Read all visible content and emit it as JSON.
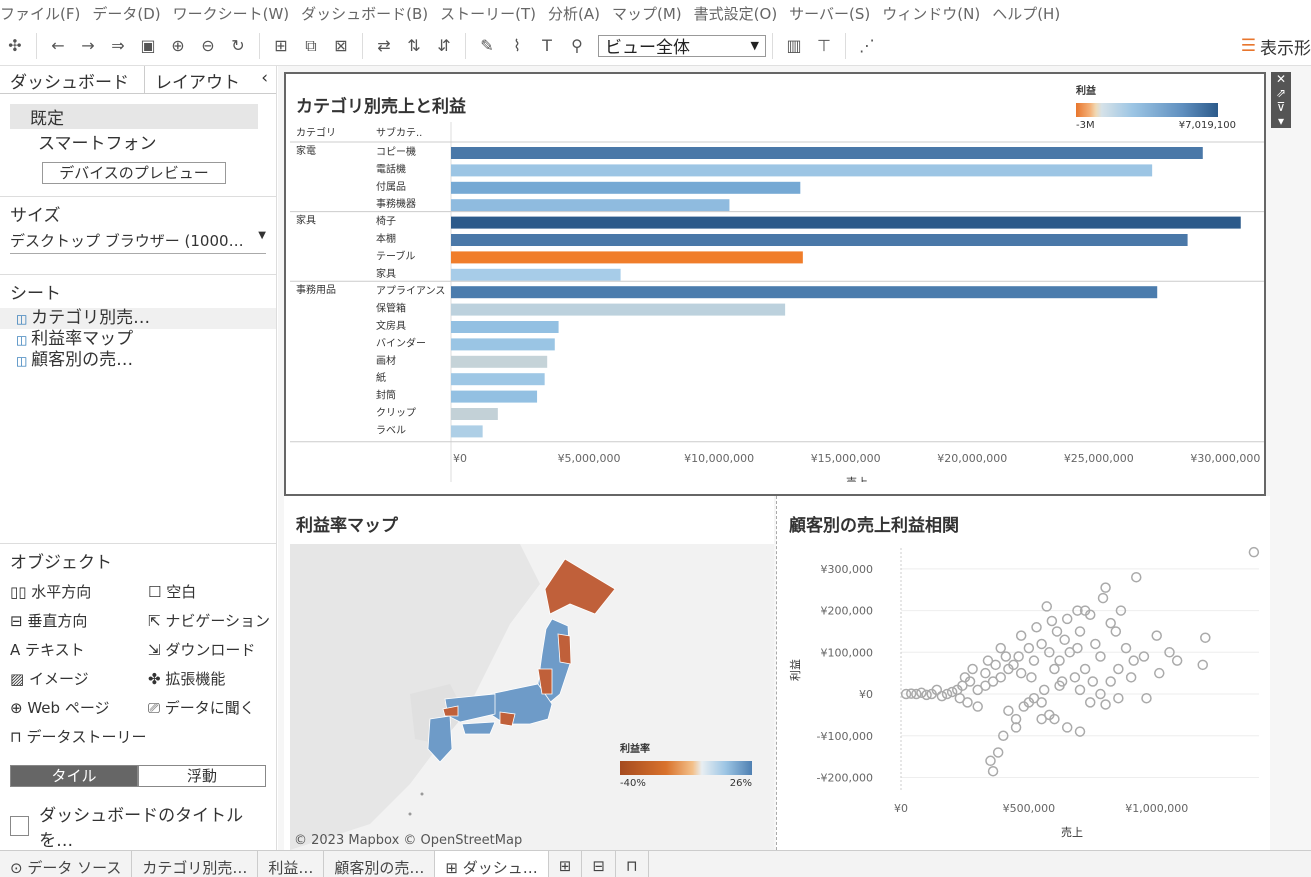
{
  "menu": [
    "ファイル(F)",
    "データ(D)",
    "ワークシート(W)",
    "ダッシュボード(B)",
    "ストーリー(T)",
    "分析(A)",
    "マップ(M)",
    "書式設定(O)",
    "サーバー(S)",
    "ウィンドウ(N)",
    "ヘルプ(H)"
  ],
  "toolbar": {
    "view_select": "ビュー全体",
    "show_me": "表示形"
  },
  "sidebar": {
    "tabs": [
      "ダッシュボード",
      "レイアウト"
    ],
    "devices": [
      "既定",
      "スマートフォン"
    ],
    "preview_button": "デバイスのプレビュー",
    "size_heading": "サイズ",
    "size_value": "デスクトップ ブラウザー (1000…",
    "sheets_heading": "シート",
    "sheets": [
      "カテゴリ別売…",
      "利益率マップ",
      "顧客別の売…"
    ],
    "objects_heading": "オブジェクト",
    "objects": [
      "水平方向",
      "空白",
      "垂直方向",
      "ナビゲーション",
      "テキスト",
      "ダウンロード",
      "イメージ",
      "拡張機能",
      "Web ページ",
      "データに聞く",
      "データストーリー"
    ],
    "tile": "タイル",
    "float": "浮動",
    "show_title": "ダッシュボードのタイトルを…"
  },
  "bottom_tabs": [
    "データ ソース",
    "カテゴリ別売…",
    "利益…",
    "顧客別の売…",
    "ダッシュ…"
  ],
  "bar_panel": {
    "title": "カテゴリ別売上と利益",
    "col_category": "カテゴリ",
    "col_subcategory": "サブカテ..",
    "legend_title": "利益",
    "legend_min": "-3M",
    "legend_max": "¥7,019,100",
    "xlabel": "売上"
  },
  "map_panel": {
    "title": "利益率マップ",
    "legend_title": "利益率",
    "legend_min": "-40%",
    "legend_max": "26%",
    "credit": "© 2023 Mapbox © OpenStreetMap"
  },
  "scatter_panel": {
    "title": "顧客別の売上利益相関",
    "xlabel": "売上",
    "ylabel": "利益"
  },
  "chart_data": [
    {
      "type": "bar",
      "title": "カテゴリ別売上と利益",
      "xlabel": "売上",
      "xlim": [
        0,
        32000000
      ],
      "xticks": [
        "¥0",
        "¥5,000,000",
        "¥10,000,000",
        "¥15,000,000",
        "¥20,000,000",
        "¥25,000,000",
        "¥30,000,000"
      ],
      "groups": [
        {
          "category": "家電",
          "items": [
            {
              "name": "コピー機",
              "value": 29700000,
              "color": "#4a78a8"
            },
            {
              "name": "電話機",
              "value": 27700000,
              "color": "#9cc5e4"
            },
            {
              "name": "付属品",
              "value": 13800000,
              "color": "#76a9d4"
            },
            {
              "name": "事務機器",
              "value": 11000000,
              "color": "#8fbbdf"
            }
          ]
        },
        {
          "category": "家具",
          "items": [
            {
              "name": "椅子",
              "value": 31200000,
              "color": "#2c5a8a"
            },
            {
              "name": "本棚",
              "value": 29100000,
              "color": "#4a78a8"
            },
            {
              "name": "テーブル",
              "value": 13900000,
              "color": "#f07d2a"
            },
            {
              "name": "家具",
              "value": 6700000,
              "color": "#a7cce8"
            }
          ]
        },
        {
          "category": "事務用品",
          "items": [
            {
              "name": "アプライアンス",
              "value": 27900000,
              "color": "#4b7cad"
            },
            {
              "name": "保管箱",
              "value": 13200000,
              "color": "#bcd1dd"
            },
            {
              "name": "文房具",
              "value": 4250000,
              "color": "#93c0e2"
            },
            {
              "name": "バインダー",
              "value": 4100000,
              "color": "#9ac5e4"
            },
            {
              "name": "画材",
              "value": 3800000,
              "color": "#c5d3d8"
            },
            {
              "name": "紙",
              "value": 3700000,
              "color": "#9ec7e5"
            },
            {
              "name": "封筒",
              "value": 3400000,
              "color": "#93c0e2"
            },
            {
              "name": "クリップ",
              "value": 1850000,
              "color": "#c3d1d7"
            },
            {
              "name": "ラベル",
              "value": 1250000,
              "color": "#aecfe6"
            }
          ]
        }
      ]
    },
    {
      "type": "scatter",
      "title": "顧客別の売上利益相関",
      "xlabel": "売上",
      "ylabel": "利益",
      "xlim": [
        0,
        1400000
      ],
      "ylim": [
        -230000,
        350000
      ],
      "xticks": [
        "¥0",
        "¥500,000",
        "¥1,000,000"
      ],
      "yticks": [
        "¥300,000",
        "¥200,000",
        "¥100,000",
        "¥0",
        "-¥100,000",
        "-¥200,000"
      ],
      "points": [
        [
          1380000,
          340000
        ],
        [
          920000,
          280000
        ],
        [
          800000,
          255000
        ],
        [
          790000,
          230000
        ],
        [
          1190000,
          135000
        ],
        [
          1000000,
          140000
        ],
        [
          1080000,
          80000
        ],
        [
          1180000,
          70000
        ],
        [
          570000,
          210000
        ],
        [
          720000,
          200000
        ],
        [
          690000,
          200000
        ],
        [
          650000,
          180000
        ],
        [
          610000,
          150000
        ],
        [
          820000,
          170000
        ],
        [
          840000,
          150000
        ],
        [
          880000,
          110000
        ],
        [
          910000,
          80000
        ],
        [
          950000,
          90000
        ],
        [
          850000,
          60000
        ],
        [
          780000,
          90000
        ],
        [
          720000,
          60000
        ],
        [
          690000,
          110000
        ],
        [
          660000,
          100000
        ],
        [
          620000,
          80000
        ],
        [
          600000,
          60000
        ],
        [
          550000,
          120000
        ],
        [
          500000,
          110000
        ],
        [
          460000,
          90000
        ],
        [
          440000,
          70000
        ],
        [
          420000,
          60000
        ],
        [
          390000,
          40000
        ],
        [
          360000,
          30000
        ],
        [
          330000,
          20000
        ],
        [
          300000,
          10000
        ],
        [
          270000,
          30000
        ],
        [
          240000,
          20000
        ],
        [
          220000,
          10000
        ],
        [
          200000,
          5000
        ],
        [
          180000,
          0
        ],
        [
          160000,
          -5000
        ],
        [
          140000,
          10000
        ],
        [
          120000,
          0
        ],
        [
          100000,
          -2000
        ],
        [
          80000,
          3000
        ],
        [
          60000,
          0
        ],
        [
          40000,
          1000
        ],
        [
          20000,
          0
        ],
        [
          420000,
          -40000
        ],
        [
          400000,
          -100000
        ],
        [
          380000,
          -140000
        ],
        [
          360000,
          -185000
        ],
        [
          350000,
          -160000
        ],
        [
          450000,
          -60000
        ],
        [
          480000,
          -30000
        ],
        [
          500000,
          -20000
        ],
        [
          520000,
          -10000
        ],
        [
          550000,
          -20000
        ],
        [
          580000,
          -50000
        ],
        [
          600000,
          -60000
        ],
        [
          650000,
          -80000
        ],
        [
          700000,
          -90000
        ],
        [
          740000,
          -20000
        ],
        [
          800000,
          -25000
        ],
        [
          780000,
          0
        ],
        [
          850000,
          -10000
        ],
        [
          750000,
          30000
        ],
        [
          680000,
          40000
        ],
        [
          620000,
          20000
        ],
        [
          560000,
          10000
        ],
        [
          510000,
          40000
        ],
        [
          470000,
          50000
        ],
        [
          520000,
          80000
        ],
        [
          580000,
          100000
        ],
        [
          640000,
          130000
        ],
        [
          700000,
          150000
        ],
        [
          760000,
          120000
        ],
        [
          300000,
          -30000
        ],
        [
          260000,
          -20000
        ],
        [
          230000,
          -10000
        ],
        [
          330000,
          50000
        ],
        [
          370000,
          70000
        ],
        [
          410000,
          90000
        ],
        [
          450000,
          -80000
        ],
        [
          550000,
          -60000
        ],
        [
          630000,
          30000
        ],
        [
          700000,
          10000
        ],
        [
          820000,
          30000
        ],
        [
          900000,
          40000
        ],
        [
          960000,
          -10000
        ],
        [
          1010000,
          50000
        ],
        [
          1050000,
          100000
        ],
        [
          860000,
          200000
        ],
        [
          740000,
          190000
        ],
        [
          590000,
          175000
        ],
        [
          530000,
          160000
        ],
        [
          470000,
          140000
        ],
        [
          390000,
          110000
        ],
        [
          340000,
          80000
        ],
        [
          280000,
          60000
        ],
        [
          250000,
          40000
        ]
      ]
    }
  ]
}
